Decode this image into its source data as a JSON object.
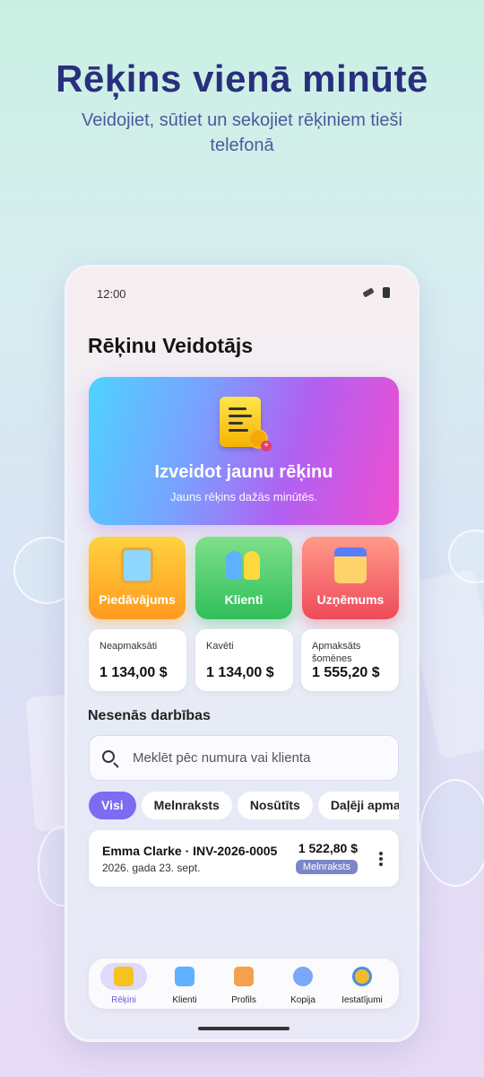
{
  "promo": {
    "title": "Rēķins vienā minūtē",
    "subtitle": "Veidojiet, sūtiet un sekojiet rēķiniem tieši telefonā"
  },
  "status_bar": {
    "time": "12:00"
  },
  "app": {
    "title": "Rēķinu Veidotājs"
  },
  "create_card": {
    "title": "Izveidot jaunu rēķinu",
    "subtitle": "Jauns rēķins dažās minūtēs.",
    "icon": "invoice-doc-icon"
  },
  "tiles": [
    {
      "label": "Piedāvājums",
      "icon": "clipboard-icon",
      "color": "#ffb52e"
    },
    {
      "label": "Klienti",
      "icon": "people-icon",
      "color": "#3dc463"
    },
    {
      "label": "Uzņēmums",
      "icon": "store-icon",
      "color": "#f2606a"
    }
  ],
  "stats": [
    {
      "label": "Neapmaksāti",
      "value": "1 134,00 $"
    },
    {
      "label": "Kavēti",
      "value": "1 134,00 $"
    },
    {
      "label": "Apmaksāts šomēnes",
      "value": "1 555,20 $"
    }
  ],
  "recent": {
    "title": "Nesenās darbības",
    "search_placeholder": "Meklēt pēc numura vai klienta",
    "filters": [
      "Visi",
      "Melnraksts",
      "Nosūtīts",
      "Daļēji apmaksāts"
    ],
    "active_filter": "Visi",
    "invoices": [
      {
        "name": "Emma Clarke · INV-2026-0005",
        "date": "2026. gada 23. sept.",
        "amount": "1 522,80 $",
        "status": "Melnraksts"
      }
    ]
  },
  "nav": [
    {
      "label": "Rēķini",
      "icon": "invoice-icon",
      "active": true
    },
    {
      "label": "Klienti",
      "icon": "people-icon",
      "active": false
    },
    {
      "label": "Profils",
      "icon": "store-icon",
      "active": false
    },
    {
      "label": "Kopija",
      "icon": "cloud-backup-icon",
      "active": false
    },
    {
      "label": "Iestatījumi",
      "icon": "gear-icon",
      "active": false
    }
  ],
  "colors": {
    "accent": "#7b6cf2",
    "title": "#2a2f7d"
  }
}
